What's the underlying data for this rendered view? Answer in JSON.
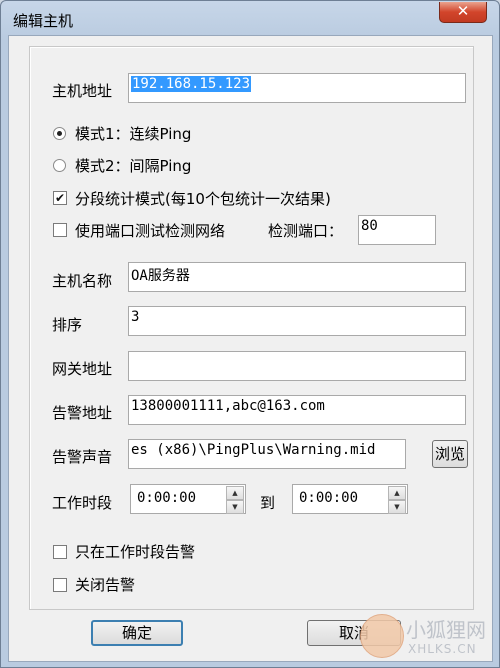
{
  "window": {
    "title": "编辑主机",
    "close_glyph": "✕"
  },
  "host_address": {
    "label": "主机地址",
    "value": "192.168.15.123"
  },
  "mode": {
    "option1": "模式1：连续Ping",
    "option2": "模式2：间隔Ping",
    "selected": 1
  },
  "segment_stats": {
    "label": "分段统计模式(每10个包统计一次结果)",
    "checked": true
  },
  "port_test": {
    "label": "使用端口测试检测网络",
    "checked": false,
    "port_label": "检测端口：",
    "port_value": "80"
  },
  "host_name": {
    "label": "主机名称",
    "value": "OA服务器"
  },
  "order": {
    "label": "排序",
    "value": "3"
  },
  "gateway": {
    "label": "网关地址",
    "value": ""
  },
  "alert_address": {
    "label": "告警地址",
    "value": "13800001111,abc@163.com"
  },
  "alert_sound": {
    "label": "告警声音",
    "value": "es (x86)\\PingPlus\\Warning.mid",
    "browse_label": "浏览"
  },
  "work_period": {
    "label": "工作时段",
    "start": "0:00:00",
    "to_label": "到",
    "end": "0:00:00"
  },
  "only_work_alert": {
    "label": "只在工作时段告警",
    "checked": false
  },
  "disable_alert": {
    "label": "关闭告警",
    "checked": false
  },
  "buttons": {
    "ok": "确定",
    "cancel": "取消"
  },
  "watermark": {
    "text": "小狐狸网",
    "sub": "XHLKS.CN"
  }
}
